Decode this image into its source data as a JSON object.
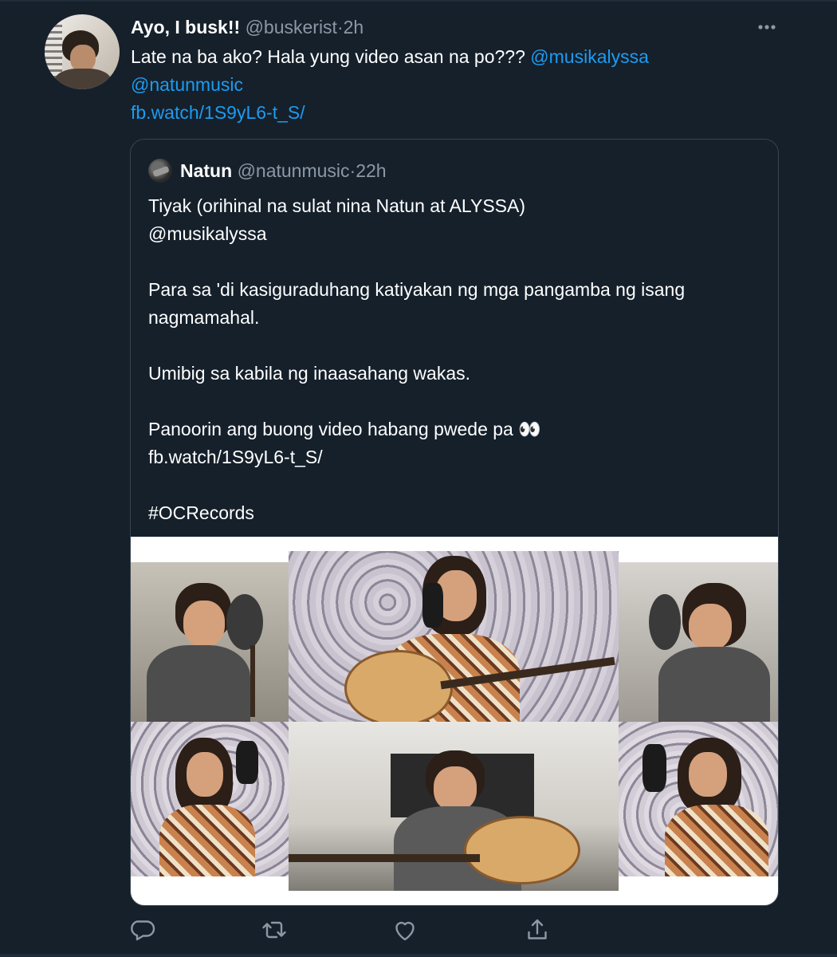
{
  "tweet": {
    "display_name": "Ayo, I busk!!",
    "handle": "@buskerist",
    "separator": "·",
    "time": "2h",
    "text_line1": "Late na ba ako? Hala yung video asan na po???",
    "mention1": "@musikalyssa",
    "mention2": "@natunmusic",
    "link": "fb.watch/1S9yL6-t_S/"
  },
  "quote": {
    "display_name": "Natun",
    "handle": "@natunmusic",
    "separator": "·",
    "time": "22h",
    "p1_line1": "Tiyak (orihinal na sulat nina Natun at ALYSSA)",
    "p1_line2": "@musikalyssa",
    "p2": "Para sa 'di kasiguraduhang katiyakan ng mga pangamba ng isang nagmamahal.",
    "p3": "Umibig sa kabila ng inaasahang wakas.",
    "p4_line1": "Panoorin ang buong video habang pwede pa 👀",
    "p4_line2": "fb.watch/1S9yL6-t_S/",
    "p5": "#OCRecords"
  },
  "icons": {
    "more": "more-icon",
    "reply": "reply-icon",
    "retweet": "retweet-icon",
    "like": "like-icon",
    "share": "share-icon"
  },
  "colors": {
    "background": "#15202b",
    "link": "#1d9bf0",
    "muted": "#8b98a5",
    "border": "#38444d"
  }
}
